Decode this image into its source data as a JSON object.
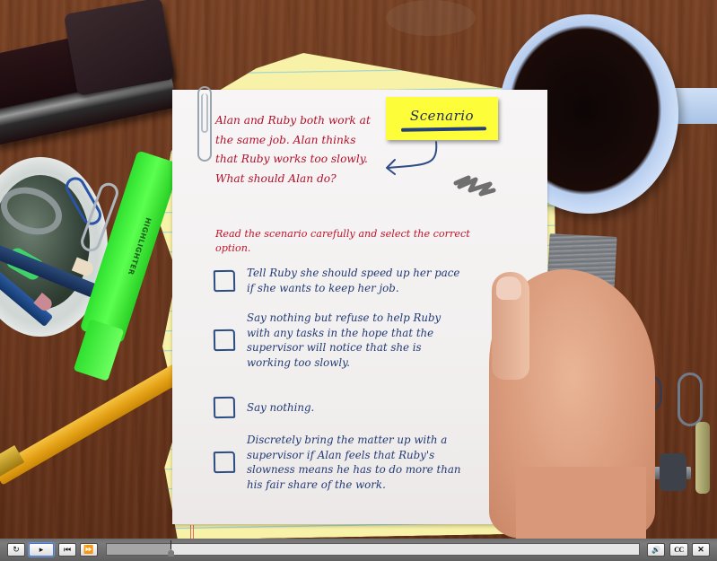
{
  "lesson": {
    "sticky_note_label": "Scenario",
    "scenario_text": "Alan and Ruby both work at the same job. Alan thinks that Ruby works too slowly. What should Alan do?",
    "instruction": "Read the scenario carefully and select the correct option.",
    "options": [
      {
        "label": "Tell Ruby she should speed up her pace if she wants to keep her job.",
        "checked": false
      },
      {
        "label": "Say nothing but refuse to help Ruby with any tasks in the hope that the supervisor will notice that she is working too slowly.",
        "checked": false
      },
      {
        "label": "Say nothing.",
        "checked": false
      },
      {
        "label": "Discretely bring the matter up with a supervisor if Alan feels that Ruby's slowness means he has to do more than his fair share of the work.",
        "checked": false
      }
    ]
  },
  "decor": {
    "highlighter_label": "HIGHLIGHTER"
  },
  "player": {
    "buttons": {
      "replay": {
        "icon": "replay-icon",
        "glyph": "↻"
      },
      "play": {
        "icon": "play-icon",
        "glyph": "▸"
      },
      "previous": {
        "icon": "skip-back-icon",
        "glyph": "⏮"
      },
      "next": {
        "icon": "fast-forward-icon",
        "glyph": "⏩"
      },
      "volume": {
        "icon": "volume-icon",
        "glyph": "🔊"
      },
      "captions": {
        "icon": "closed-captions-icon",
        "label": "CC"
      },
      "close": {
        "icon": "close-icon",
        "glyph": "✕"
      }
    },
    "progress_fraction": 0.12,
    "focused_button": "play"
  },
  "colors": {
    "scenario_text": "#b0102a",
    "option_text": "#223a74",
    "sticky_note": "#fdfd3a"
  }
}
